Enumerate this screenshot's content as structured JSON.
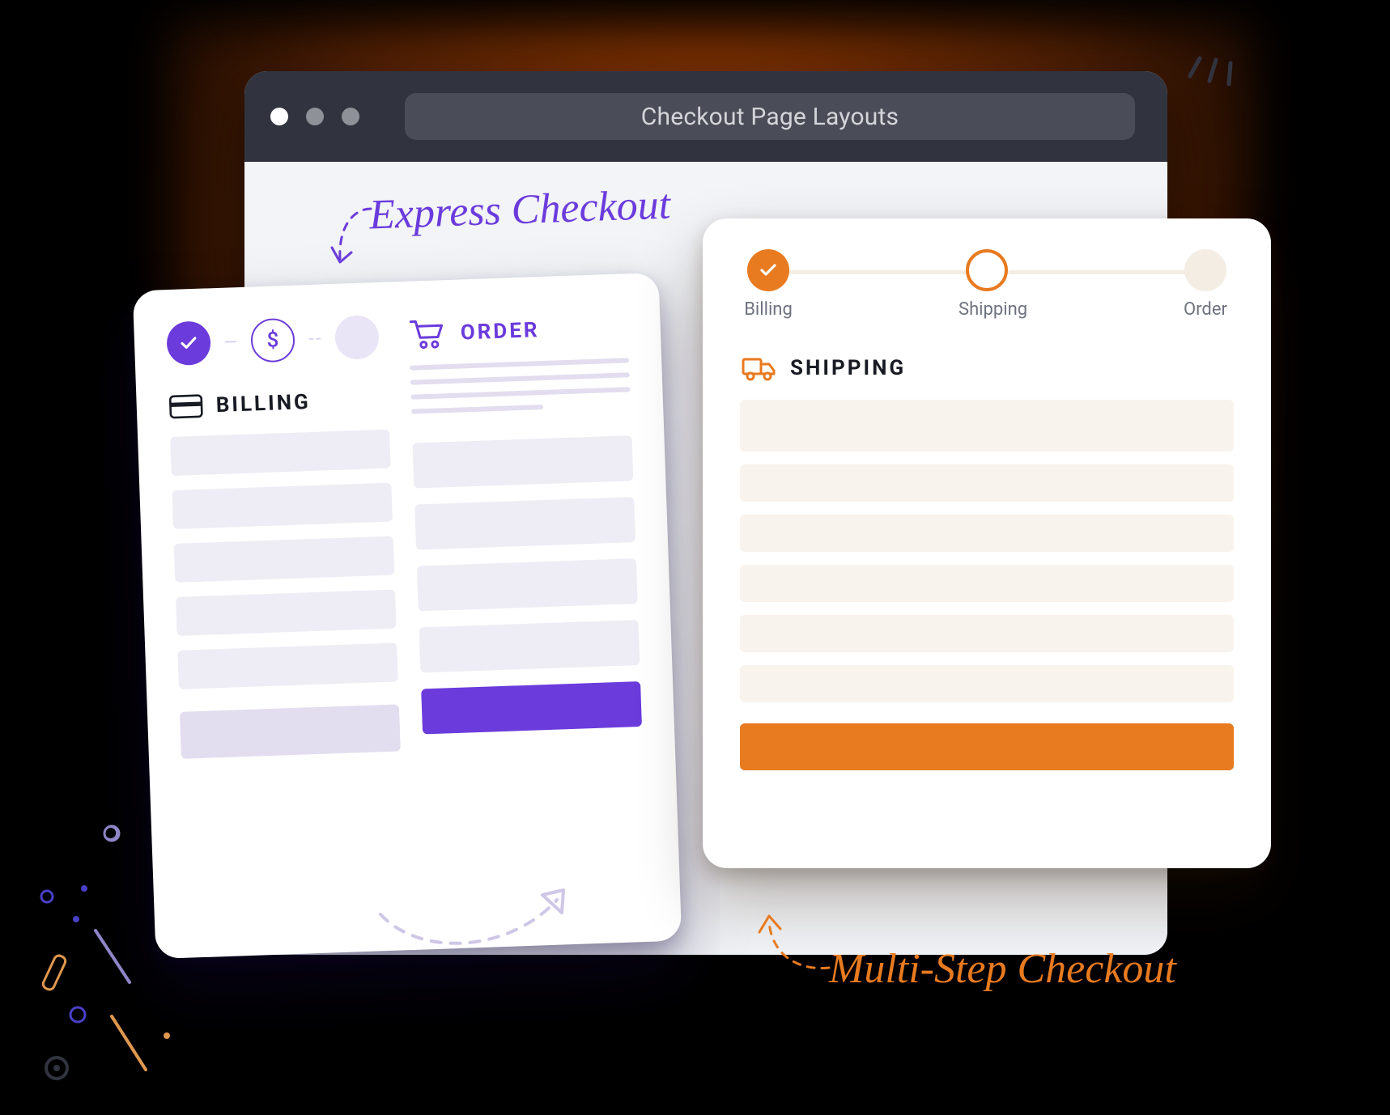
{
  "browser": {
    "title": "Checkout Page Layouts"
  },
  "labels": {
    "express": "Express Checkout",
    "multi": "Multi-Step Checkout"
  },
  "express_card": {
    "left": {
      "section_title": "BILLING"
    },
    "right": {
      "section_title": "ORDER"
    }
  },
  "multi_card": {
    "steps": [
      {
        "label": "Billing"
      },
      {
        "label": "Shipping"
      },
      {
        "label": "Order"
      }
    ],
    "section_title": "SHIPPING"
  },
  "colors": {
    "purple": "#6b3bdc",
    "orange": "#e87a1f"
  }
}
